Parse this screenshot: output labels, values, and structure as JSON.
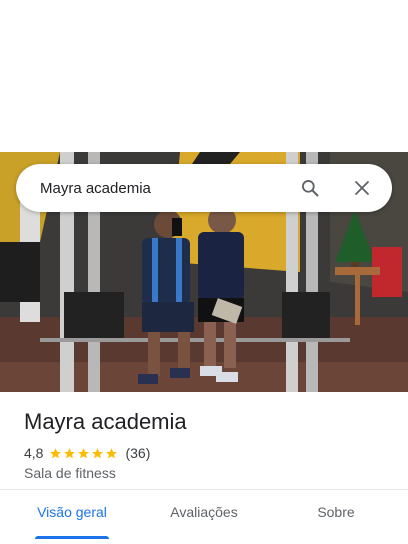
{
  "search": {
    "query": "Mayra academia"
  },
  "place": {
    "name": "Mayra academia",
    "rating": "4,8",
    "stars": 5,
    "review_count": "(36)",
    "category": "Sala de fitness"
  },
  "tabs": [
    {
      "label": "Visão geral",
      "active": true
    },
    {
      "label": "Avaliações",
      "active": false
    },
    {
      "label": "Sobre",
      "active": false
    }
  ],
  "colors": {
    "accent": "#1a73e8",
    "star": "#fbbc04",
    "text": "#202124",
    "muted": "#5f6368"
  },
  "icons": {
    "search": "search-icon",
    "close": "close-icon",
    "star": "star-icon"
  }
}
